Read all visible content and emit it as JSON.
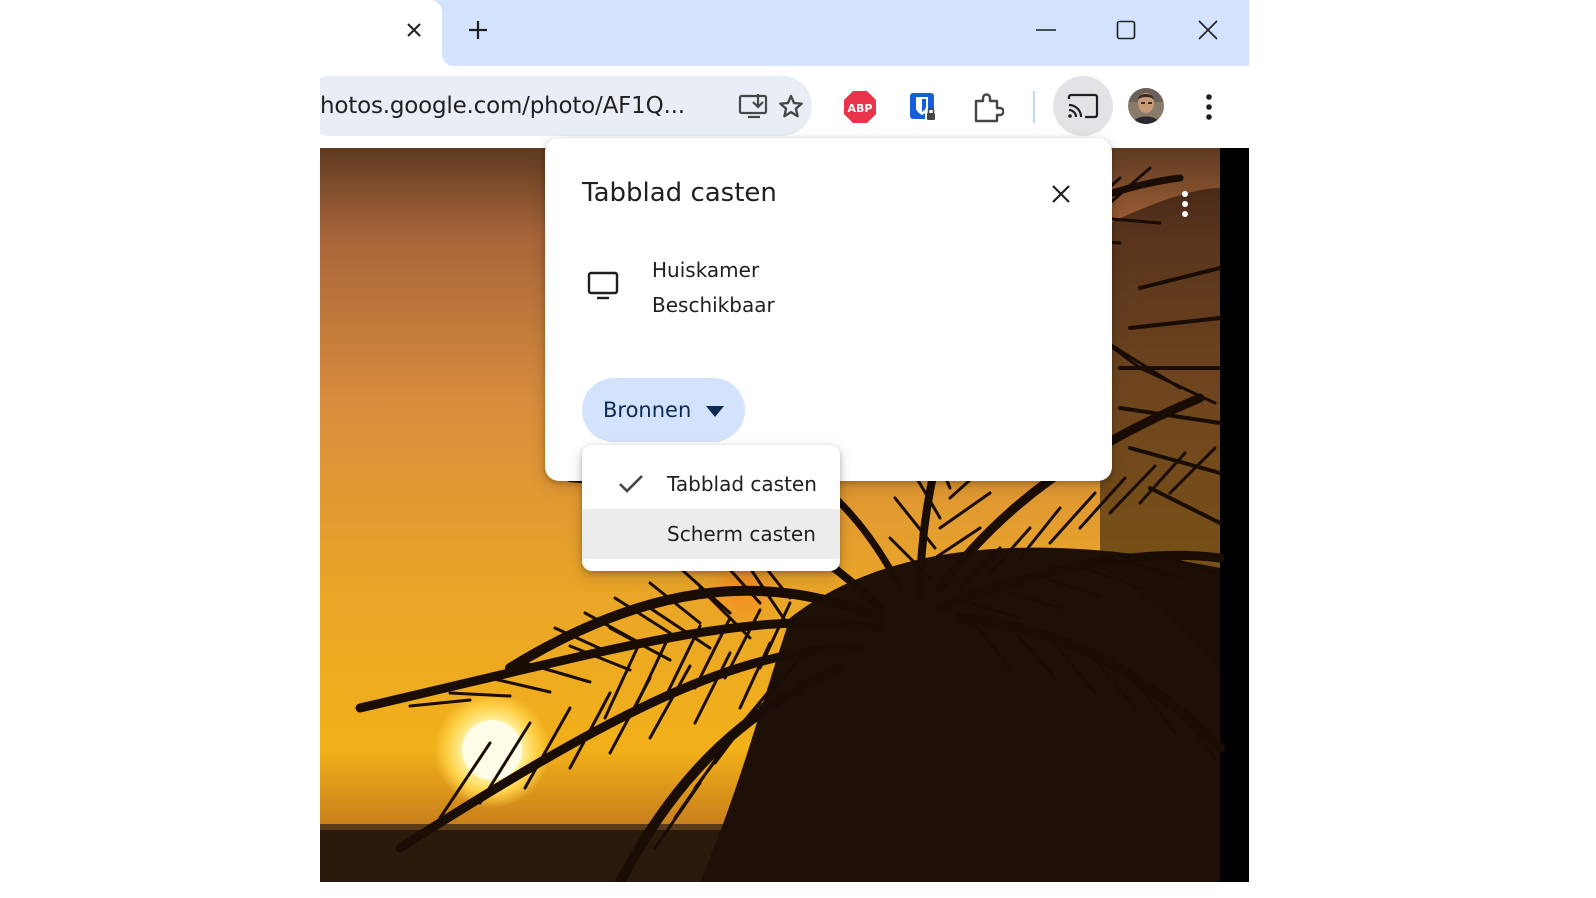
{
  "browser": {
    "tab_close_icon": "close-icon",
    "new_tab_icon": "plus-icon",
    "window_controls": [
      "minimize-icon",
      "maximize-icon",
      "close-icon"
    ],
    "address_bar": {
      "url": "hotos.google.com/photo/AF1Q..."
    },
    "toolbar_icons": [
      "install-app-icon",
      "bookmark-star-icon",
      "adblock-plus-icon",
      "bitwarden-icon",
      "extensions-puzzle-icon",
      "cast-icon",
      "profile-avatar",
      "more-vert-icon"
    ],
    "colors": {
      "tabstrip": "#d3e3fd",
      "omnibox": "#e9eef6",
      "accent": "#0b57d0"
    }
  },
  "extension": {
    "abp_label": "ABP"
  },
  "cast_dialog": {
    "title": "Tabblad casten",
    "device": {
      "name": "Huiskamer",
      "status": "Beschikbaar"
    },
    "sources_button": "Bronnen",
    "sources_menu": [
      {
        "label": "Tabblad casten",
        "checked": true
      },
      {
        "label": "Scherm casten",
        "checked": false
      }
    ]
  }
}
